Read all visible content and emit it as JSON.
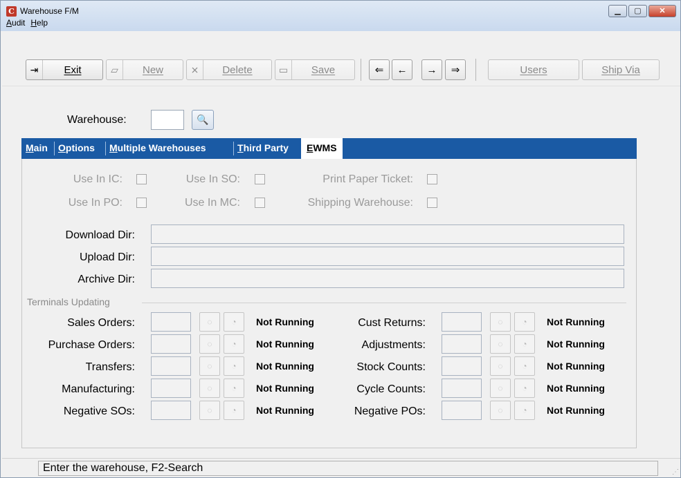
{
  "window": {
    "title": "Warehouse F/M",
    "controls": {
      "minimize": "▁",
      "maximize": "▢",
      "close": "✕"
    }
  },
  "menu": {
    "items": [
      "Audit",
      "Help"
    ]
  },
  "toolbar": {
    "exit_label": "Exit",
    "new_label": "New",
    "delete_label": "Delete",
    "save_label": "Save",
    "first_glyph": "⇐",
    "prev_glyph": "←",
    "next_glyph": "→",
    "last_glyph": "⇒",
    "users_label": "Users",
    "shipvia_label": "Ship Via"
  },
  "warehouse": {
    "label": "Warehouse:",
    "value": ""
  },
  "tabs": [
    {
      "label": "Main",
      "active": false
    },
    {
      "label": "Options",
      "active": false
    },
    {
      "label": "Multiple Warehouses",
      "active": false
    },
    {
      "label": "Third Party",
      "active": false
    },
    {
      "label": "EWMS",
      "active": true
    }
  ],
  "ewms": {
    "checkboxes": [
      {
        "label": "Use In IC:",
        "checked": false
      },
      {
        "label": "Use In SO:",
        "checked": false
      },
      {
        "label": "Print Paper Ticket:",
        "checked": false
      },
      {
        "label": "Use In PO:",
        "checked": false
      },
      {
        "label": "Use In MC:",
        "checked": false
      },
      {
        "label": "Shipping Warehouse:",
        "checked": false
      }
    ],
    "dirs": [
      {
        "label": "Download Dir:",
        "value": ""
      },
      {
        "label": "Upload Dir:",
        "value": ""
      },
      {
        "label": "Archive Dir:",
        "value": ""
      }
    ],
    "terminals_group": "Terminals Updating",
    "terminals_left": [
      {
        "label": "Sales Orders:",
        "status": "Not Running"
      },
      {
        "label": "Purchase Orders:",
        "status": "Not Running"
      },
      {
        "label": "Transfers:",
        "status": "Not Running"
      },
      {
        "label": "Manufacturing:",
        "status": "Not Running"
      },
      {
        "label": "Negative SOs:",
        "status": "Not Running"
      }
    ],
    "terminals_right": [
      {
        "label": "Cust Returns:",
        "status": "Not Running"
      },
      {
        "label": "Adjustments:",
        "status": "Not Running"
      },
      {
        "label": "Stock Counts:",
        "status": "Not Running"
      },
      {
        "label": "Cycle Counts:",
        "status": "Not Running"
      },
      {
        "label": "Negative POs:",
        "status": "Not Running"
      }
    ]
  },
  "statusbar": {
    "message": "Enter the warehouse, F2-Search"
  },
  "colors": {
    "tab_bar": "#1a5aa4",
    "close_button": "#c7402b"
  }
}
